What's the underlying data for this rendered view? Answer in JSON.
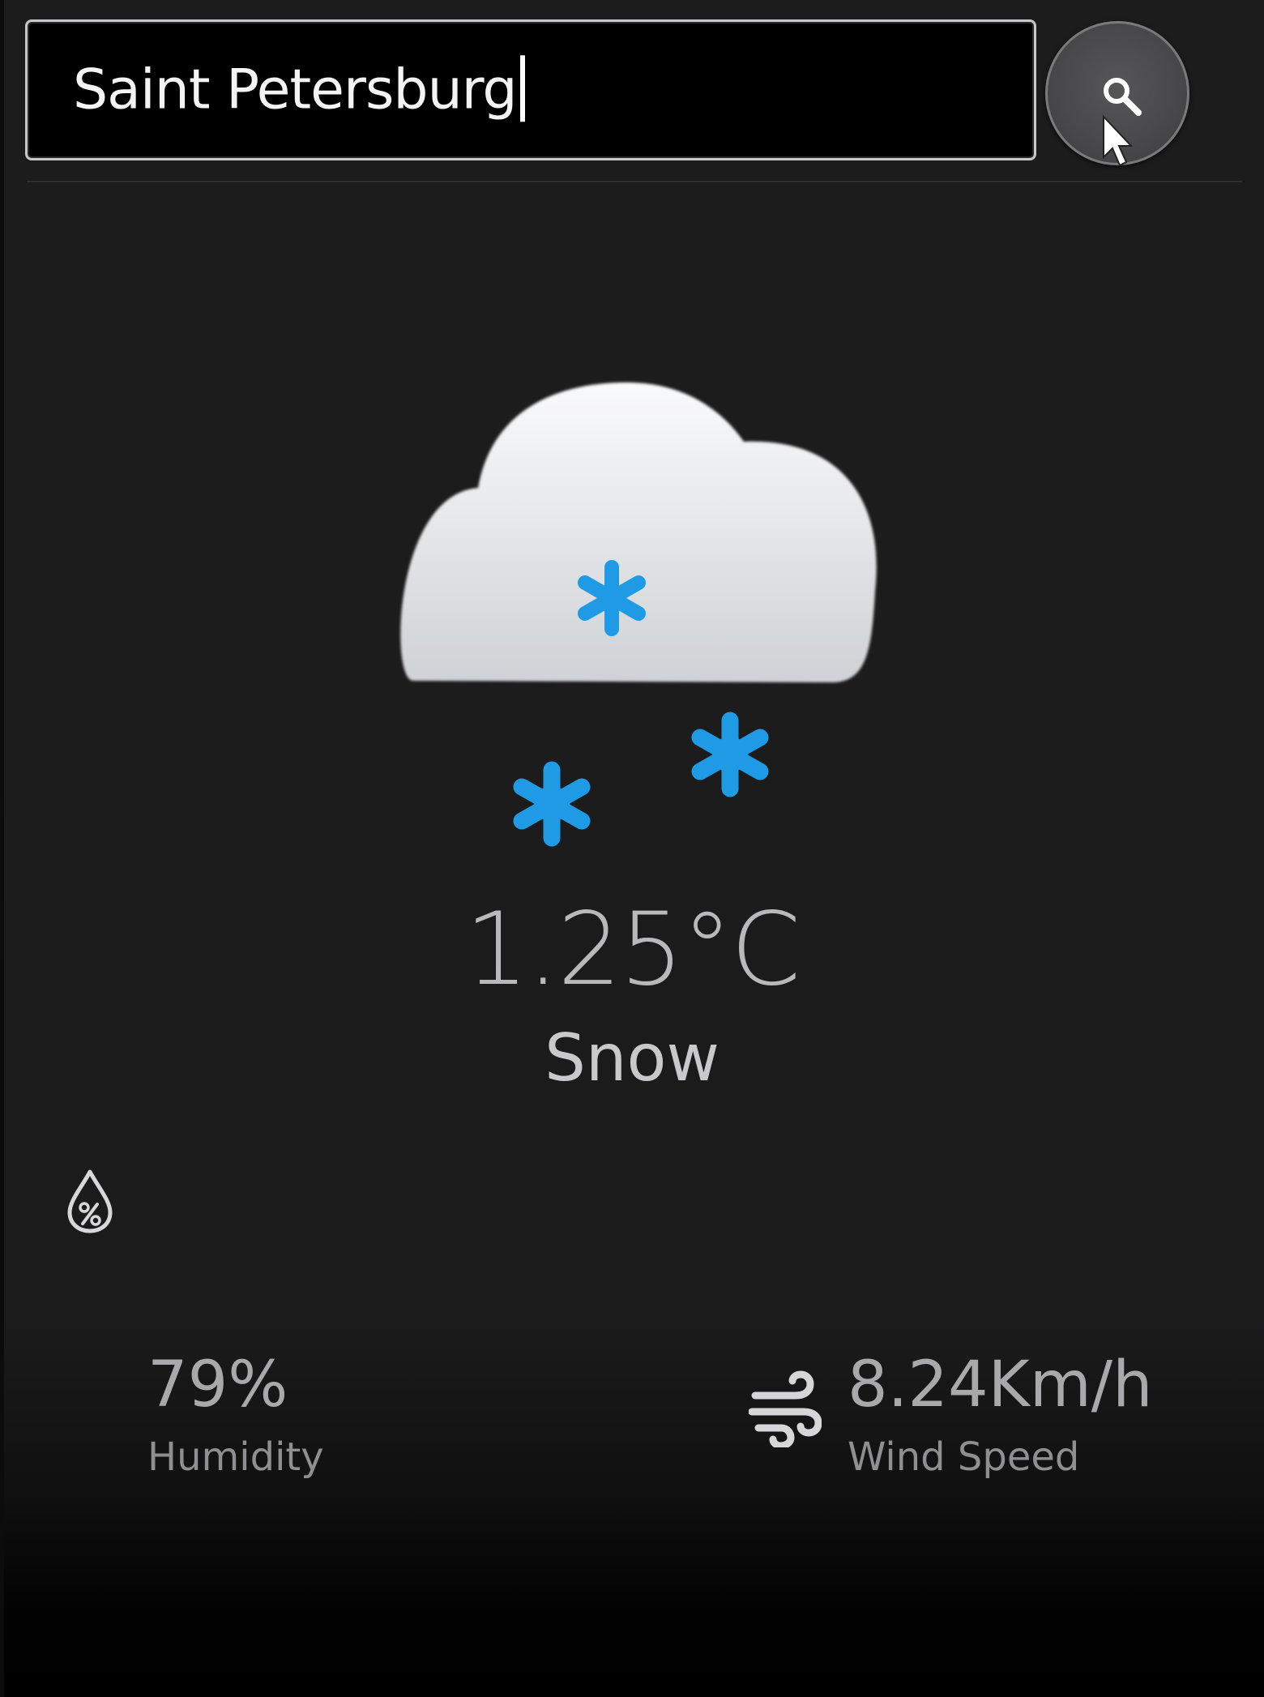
{
  "search": {
    "value": "Saint Petersburg",
    "button_icon": "search-icon"
  },
  "weather": {
    "icon": "snow-cloud-icon",
    "temperature": "1.25°C",
    "condition": "Snow"
  },
  "stats": {
    "humidity": {
      "icon": "humidity-icon",
      "value": "79%",
      "label": "Humidity"
    },
    "wind": {
      "icon": "wind-icon",
      "value": "8.24Km/h",
      "label": "Wind Speed"
    }
  },
  "colors": {
    "background": "#1b1b1c",
    "snowflake": "#1f9be6",
    "cloud": "#eceef1",
    "text": "#b9b9bb"
  }
}
